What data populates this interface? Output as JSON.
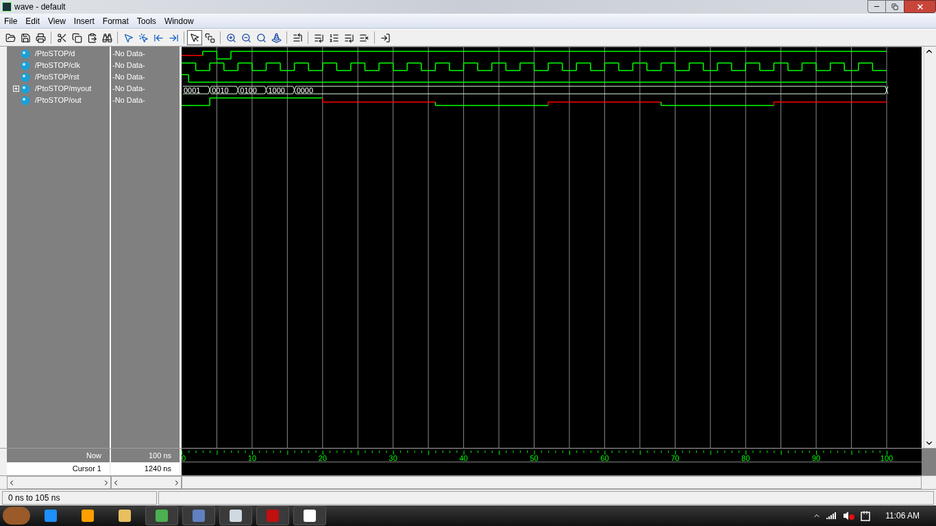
{
  "window": {
    "title": "wave - default"
  },
  "menu": [
    "File",
    "Edit",
    "View",
    "Insert",
    "Format",
    "Tools",
    "Window"
  ],
  "signals": [
    {
      "name": "/PtoSTOP/d",
      "value": "-No Data-",
      "kind": "bit"
    },
    {
      "name": "/PtoSTOP/clk",
      "value": "-No Data-",
      "kind": "bit"
    },
    {
      "name": "/PtoSTOP/rst",
      "value": "-No Data-",
      "kind": "bit"
    },
    {
      "name": "/PtoSTOP/myout",
      "value": "-No Data-",
      "kind": "bus",
      "segments": [
        "0001",
        "0010",
        "0100",
        "1000",
        "0000"
      ]
    },
    {
      "name": "/PtoSTOP/out",
      "value": "-No Data-",
      "kind": "bit"
    }
  ],
  "time_readouts": [
    {
      "label": "Now",
      "value": "100 ns",
      "selected": false
    },
    {
      "label": "Cursor 1",
      "value": "1240 ns",
      "selected": true
    }
  ],
  "timeline": {
    "ticks": [
      "0",
      "10",
      "20",
      "30",
      "40",
      "50",
      "60",
      "70",
      "80",
      "90",
      "100"
    ]
  },
  "status_bar": {
    "range": "0 ns to 105 ns"
  },
  "taskbar": {
    "clock": "11:06 AM"
  }
}
